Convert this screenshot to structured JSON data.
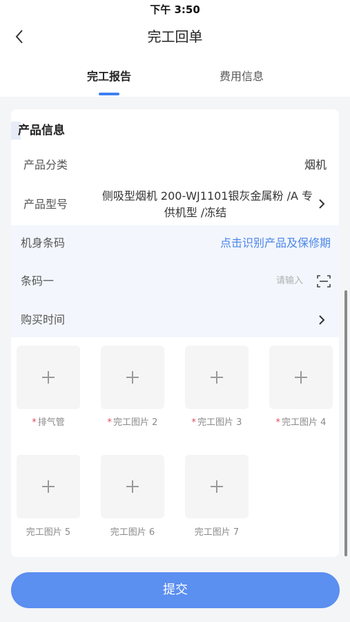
{
  "status_bar": {
    "time": "下午 3:50"
  },
  "header": {
    "title": "完工回单",
    "back_icon": "chevron-left-icon"
  },
  "tabs": [
    {
      "label": "完工报告",
      "active": true
    },
    {
      "label": "费用信息",
      "active": false
    }
  ],
  "product_section": {
    "title": "产品信息",
    "category": {
      "label": "产品分类",
      "value": "烟机"
    },
    "model": {
      "label": "产品型号",
      "value_line1": "侧吸型烟机 200-WJ1101银灰金属粉 /A 专",
      "value_line2": "供机型 /冻结"
    },
    "body_code": {
      "label": "机身条码",
      "action": "点击识别产品及保修期"
    },
    "barcode": {
      "label": "条码一",
      "placeholder": "请输入"
    },
    "purchase_time": {
      "label": "购买时间"
    }
  },
  "photos": [
    {
      "label": "排气管",
      "required": true
    },
    {
      "label": "完工图片 2",
      "required": true
    },
    {
      "label": "完工图片 3",
      "required": true
    },
    {
      "label": "完工图片 4",
      "required": true
    },
    {
      "label": "完工图片 5",
      "required": false
    },
    {
      "label": "完工图片 6",
      "required": false
    },
    {
      "label": "完工图片 7",
      "required": false
    }
  ],
  "required_mark": "*",
  "submit": {
    "label": "提交"
  },
  "colors": {
    "accent": "#3f7ff3",
    "button": "#5b8ff0",
    "link": "#4a86e8",
    "required": "#e0475a"
  }
}
